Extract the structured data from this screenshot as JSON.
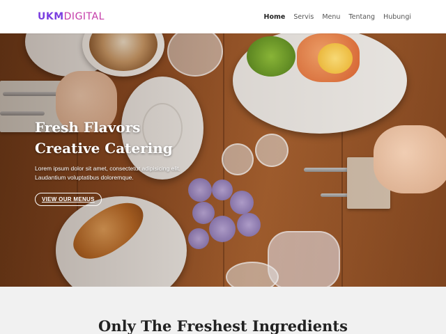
{
  "brand": {
    "part1": "UKM",
    "part2": "DIGITAL"
  },
  "nav": {
    "items": [
      {
        "label": "Home",
        "active": true
      },
      {
        "label": "Servis",
        "active": false
      },
      {
        "label": "Menu",
        "active": false
      },
      {
        "label": "Tentang",
        "active": false
      },
      {
        "label": "Hubungi",
        "active": false
      }
    ]
  },
  "hero": {
    "title_line1": "Fresh Flavors",
    "title_line2": "Creative Catering",
    "text": "Lorem ipsum dolor sit amet, consectetur adipisicing elit. Laudantium voluptatibus doloremque.",
    "button_label": "VIEW OUR MENUS"
  },
  "section": {
    "title": "Only The Freshest Ingredients"
  },
  "colors": {
    "brand_primary": "#7b3fe0",
    "brand_secondary": "#c43aa8",
    "section_bg": "#f1f1f1"
  }
}
